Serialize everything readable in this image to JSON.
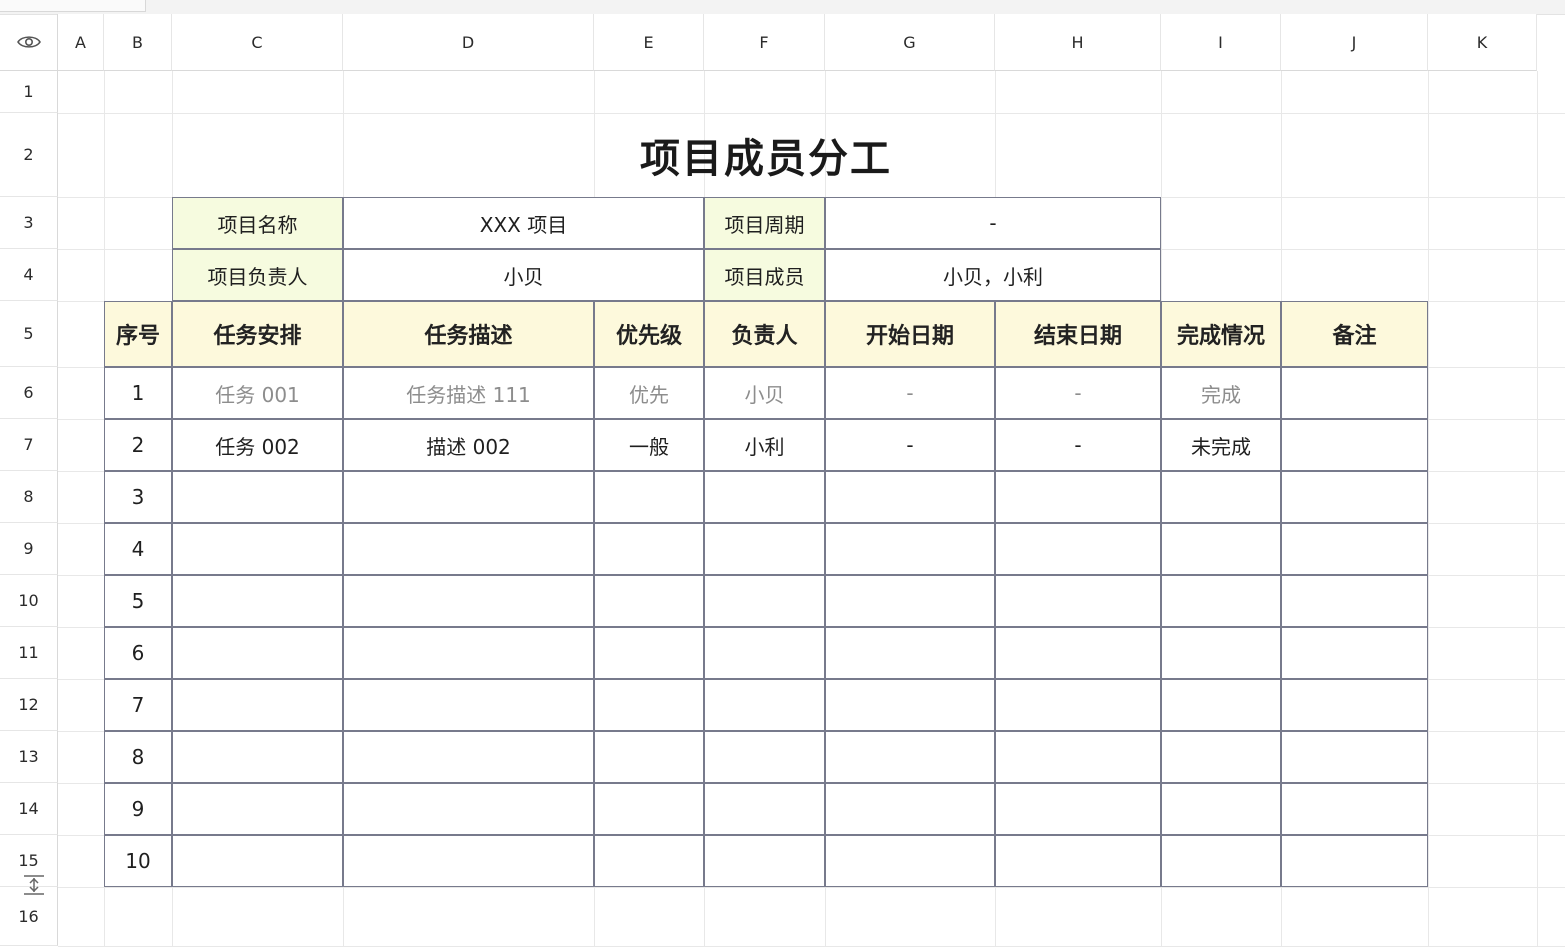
{
  "columns": [
    "A",
    "B",
    "C",
    "D",
    "E",
    "F",
    "G",
    "H",
    "I",
    "J",
    "K"
  ],
  "rows": [
    "1",
    "2",
    "3",
    "4",
    "5",
    "6",
    "7",
    "8",
    "9",
    "10",
    "11",
    "12",
    "13",
    "14",
    "15",
    "16"
  ],
  "sheet": {
    "title": "项目成员分工",
    "info": {
      "name_label": "项目名称",
      "name_value": "XXX 项目",
      "period_label": "项目周期",
      "period_value": "-",
      "owner_label": "项目负责人",
      "owner_value": "小贝",
      "members_label": "项目成员",
      "members_value": "小贝，小利"
    },
    "headers": [
      "序号",
      "任务安排",
      "任务描述",
      "优先级",
      "负责人",
      "开始日期",
      "结束日期",
      "完成情况",
      "备注"
    ],
    "table_rows": [
      {
        "no": "1",
        "task": "任务 001",
        "desc": "任务描述 111",
        "priority": "优先",
        "owner": "小贝",
        "start": "-",
        "end": "-",
        "status": "完成",
        "note": "",
        "muted": true
      },
      {
        "no": "2",
        "task": "任务 002",
        "desc": "描述 002",
        "priority": "一般",
        "owner": "小利",
        "start": "-",
        "end": "-",
        "status": "未完成",
        "note": "",
        "muted": false
      },
      {
        "no": "3",
        "task": "",
        "desc": "",
        "priority": "",
        "owner": "",
        "start": "",
        "end": "",
        "status": "",
        "note": "",
        "muted": false
      },
      {
        "no": "4",
        "task": "",
        "desc": "",
        "priority": "",
        "owner": "",
        "start": "",
        "end": "",
        "status": "",
        "note": "",
        "muted": false
      },
      {
        "no": "5",
        "task": "",
        "desc": "",
        "priority": "",
        "owner": "",
        "start": "",
        "end": "",
        "status": "",
        "note": "",
        "muted": false
      },
      {
        "no": "6",
        "task": "",
        "desc": "",
        "priority": "",
        "owner": "",
        "start": "",
        "end": "",
        "status": "",
        "note": "",
        "muted": false
      },
      {
        "no": "7",
        "task": "",
        "desc": "",
        "priority": "",
        "owner": "",
        "start": "",
        "end": "",
        "status": "",
        "note": "",
        "muted": false
      },
      {
        "no": "8",
        "task": "",
        "desc": "",
        "priority": "",
        "owner": "",
        "start": "",
        "end": "",
        "status": "",
        "note": "",
        "muted": false
      },
      {
        "no": "9",
        "task": "",
        "desc": "",
        "priority": "",
        "owner": "",
        "start": "",
        "end": "",
        "status": "",
        "note": "",
        "muted": false
      },
      {
        "no": "10",
        "task": "",
        "desc": "",
        "priority": "",
        "owner": "",
        "start": "",
        "end": "",
        "status": "",
        "note": "",
        "muted": false
      }
    ]
  },
  "icons": {
    "visibility": "eye-icon",
    "collapse": "collapse-rows-icon"
  },
  "colors": {
    "label_fill": "#f6fbdf",
    "header_fill": "#fdf9dc",
    "border": "#777a8c",
    "muted_text": "#8d8d8d"
  }
}
